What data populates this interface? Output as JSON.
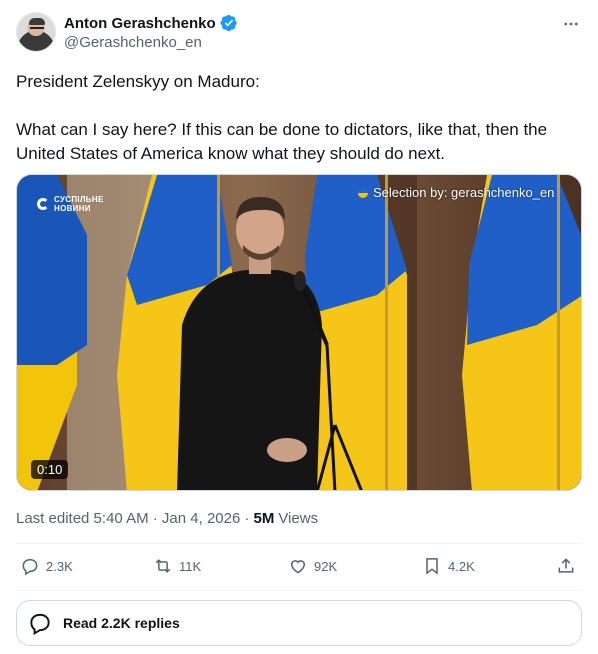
{
  "author": {
    "display_name": "Anton Gerashchenko",
    "handle": "@Gerashchenko_en",
    "verified": true
  },
  "tweet": {
    "line1": "President Zelenskyy on Maduro:",
    "line2": "What can I say here? If this can be done to dictators, like that, then the United States of America know what they should do next."
  },
  "media": {
    "channel_logo": "СУСПІЛЬНЕ НОВИНИ",
    "watermark": "Selection by: gerashchenko_en",
    "duration": "0:10"
  },
  "meta": {
    "edited": "Last edited 5:40 AM · Jan 4, 2026 ·",
    "views_count": "5M",
    "views_label": "Views"
  },
  "actions": {
    "reply": "2.3K",
    "repost": "11K",
    "like": "92K",
    "bookmark": "4.2K"
  },
  "replies_button": "Read 2.2K replies",
  "colors": {
    "verified_blue": "#1d9bf0",
    "secondary_text": "#536471",
    "flag_blue": "#1f64d6",
    "flag_yellow": "#f5c400"
  }
}
